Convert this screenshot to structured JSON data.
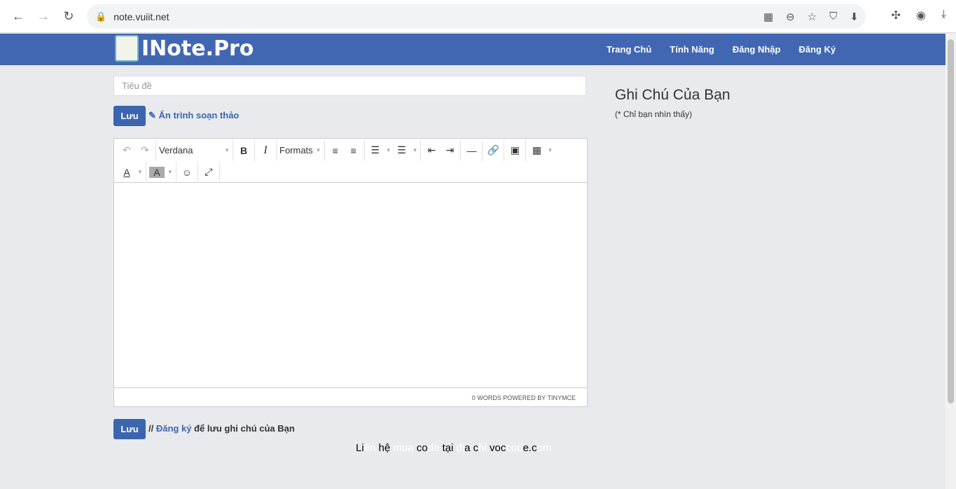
{
  "browser": {
    "url": "note.vuiit.net"
  },
  "nav": {
    "logo": "INote.Pro",
    "items": [
      "Trang Chủ",
      "Tính Năng",
      "Đăng Nhập",
      "Đăng Ký"
    ]
  },
  "form": {
    "title_placeholder": "Tiêu đề",
    "save_label": "Lưu",
    "hide_editor": "Ẩn trình soạn thảo"
  },
  "editor": {
    "font": "Verdana",
    "formats": "Formats",
    "status": "0 WORDS POWERED BY TINYMCE"
  },
  "bottom": {
    "save_label": "Lưu",
    "prefix": "//",
    "register": "Đăng ký",
    "suffix": "để lưu ghi chú của Bạn"
  },
  "sidebar": {
    "heading": "Ghi Chú Của Bạn",
    "note": "(* Chỉ bạn nhìn thấy)"
  },
  "footer": {
    "segments": [
      {
        "t": "Li",
        "c": "#000000"
      },
      {
        "t": "ên ",
        "c": "#ffffff"
      },
      {
        "t": "hệ ",
        "c": "#000000"
      },
      {
        "t": "mua ",
        "c": "#ffffff"
      },
      {
        "t": "co",
        "c": "#000000"
      },
      {
        "t": "de ",
        "c": "#ffffff"
      },
      {
        "t": "tại ",
        "c": "#000000"
      },
      {
        "t": "đị",
        "c": "#ffffff"
      },
      {
        "t": "a c",
        "c": "#000000"
      },
      {
        "t": "hỉ ",
        "c": "#ffffff"
      },
      {
        "t": "voc",
        "c": "#000000"
      },
      {
        "t": "cod",
        "c": "#ffffff"
      },
      {
        "t": "e.c",
        "c": "#000000"
      },
      {
        "t": "om",
        "c": "#ffffff"
      }
    ]
  },
  "colors": {
    "brand": "#4267b2",
    "button": "#3c65b0"
  }
}
